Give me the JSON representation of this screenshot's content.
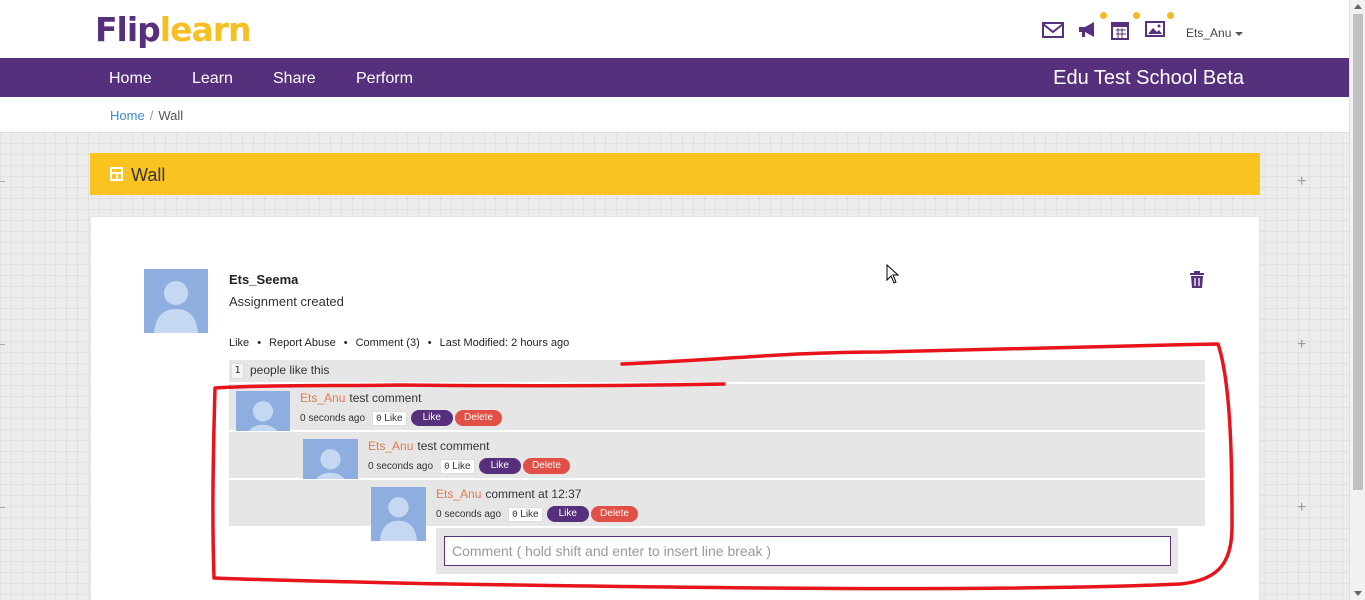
{
  "header": {
    "logo_part1": "Flip",
    "logo_part2": "learn",
    "icons": [
      "mail-icon",
      "announcement-icon",
      "calendar-icon",
      "gallery-icon"
    ],
    "user": "Ets_Anu"
  },
  "nav": {
    "items": [
      "Home",
      "Learn",
      "Share",
      "Perform"
    ],
    "school": "Edu Test School Beta"
  },
  "breadcrumb": {
    "home": "Home",
    "separator": "/",
    "current": "Wall"
  },
  "wall": {
    "title": "Wall"
  },
  "post": {
    "author": "Ets_Seema",
    "text": "Assignment created",
    "actions": {
      "like": "Like",
      "report": "Report Abuse",
      "comment": "Comment (3)",
      "modified": "Last Modified: 2 hours ago",
      "bullet": "•"
    },
    "likes_count": "1",
    "likes_text": "people like this",
    "comments": [
      {
        "author": "Ets_Anu",
        "text": "test comment",
        "time": "0 seconds ago",
        "like_count": "0",
        "like_count_label": "Like",
        "like_btn": "Like",
        "delete_btn": "Delete"
      },
      {
        "author": "Ets_Anu",
        "text": "test comment",
        "time": "0 seconds ago",
        "like_count": "0",
        "like_count_label": "Like",
        "like_btn": "Like",
        "delete_btn": "Delete"
      },
      {
        "author": "Ets_Anu",
        "text": "comment at 12:37",
        "time": "0 seconds ago",
        "like_count": "0",
        "like_count_label": "Like",
        "like_btn": "Like",
        "delete_btn": "Delete"
      }
    ],
    "comment_placeholder": "Comment ( hold shift and enter to insert line break )"
  },
  "colors": {
    "brand_purple": "#57307d",
    "brand_yellow": "#fbc31f",
    "delete_red": "#e05046",
    "author_orange": "#e07c49",
    "annotation_red": "#e8141b"
  }
}
